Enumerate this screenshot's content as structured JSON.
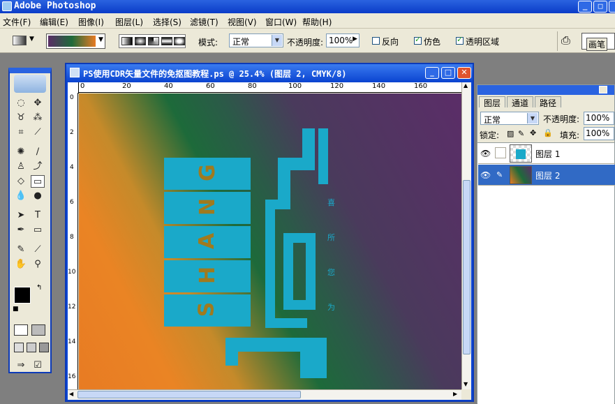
{
  "app": {
    "title": "Adobe Photoshop"
  },
  "menu": [
    "文件(F)",
    "编辑(E)",
    "图像(I)",
    "图层(L)",
    "选择(S)",
    "滤镜(T)",
    "视图(V)",
    "窗口(W)",
    "帮助(H)"
  ],
  "options": {
    "mode_label": "模式:",
    "mode_value": "正常",
    "opacity_label": "不透明度:",
    "opacity_value": "100%",
    "reverse_label": "反向",
    "dither_label": "仿色",
    "transparency_label": "透明区域",
    "brushes_tab": "画笔"
  },
  "document": {
    "title": "PS使用CDR矢量文件的免抠图教程.ps @ 25.4% (图层 2, CMYK/8)",
    "ruler_h": [
      "0",
      "20",
      "40",
      "60",
      "80",
      "100",
      "120",
      "140",
      "160"
    ],
    "ruler_v": [
      "0",
      "2",
      "4",
      "6",
      "8",
      "10",
      "12",
      "14",
      "16"
    ]
  },
  "artwork": {
    "letters": [
      "G",
      "N",
      "A",
      "H",
      "S"
    ],
    "side_chars": [
      "喜",
      "所",
      "您",
      "为"
    ],
    "color": "#1aa9c9"
  },
  "layers_panel": {
    "tabs": [
      "图层",
      "通道",
      "路径"
    ],
    "blend_mode": "正常",
    "opacity_label": "不透明度:",
    "opacity_value": "100%",
    "lock_label": "锁定:",
    "fill_label": "填充:",
    "fill_value": "100%",
    "layers": [
      {
        "name": "图层 1",
        "selected": false
      },
      {
        "name": "图层 2",
        "selected": true
      }
    ]
  },
  "colors": {
    "accent": "#0c47d6",
    "selected_layer": "#316ac5",
    "text_gold": "#a07a1e"
  }
}
